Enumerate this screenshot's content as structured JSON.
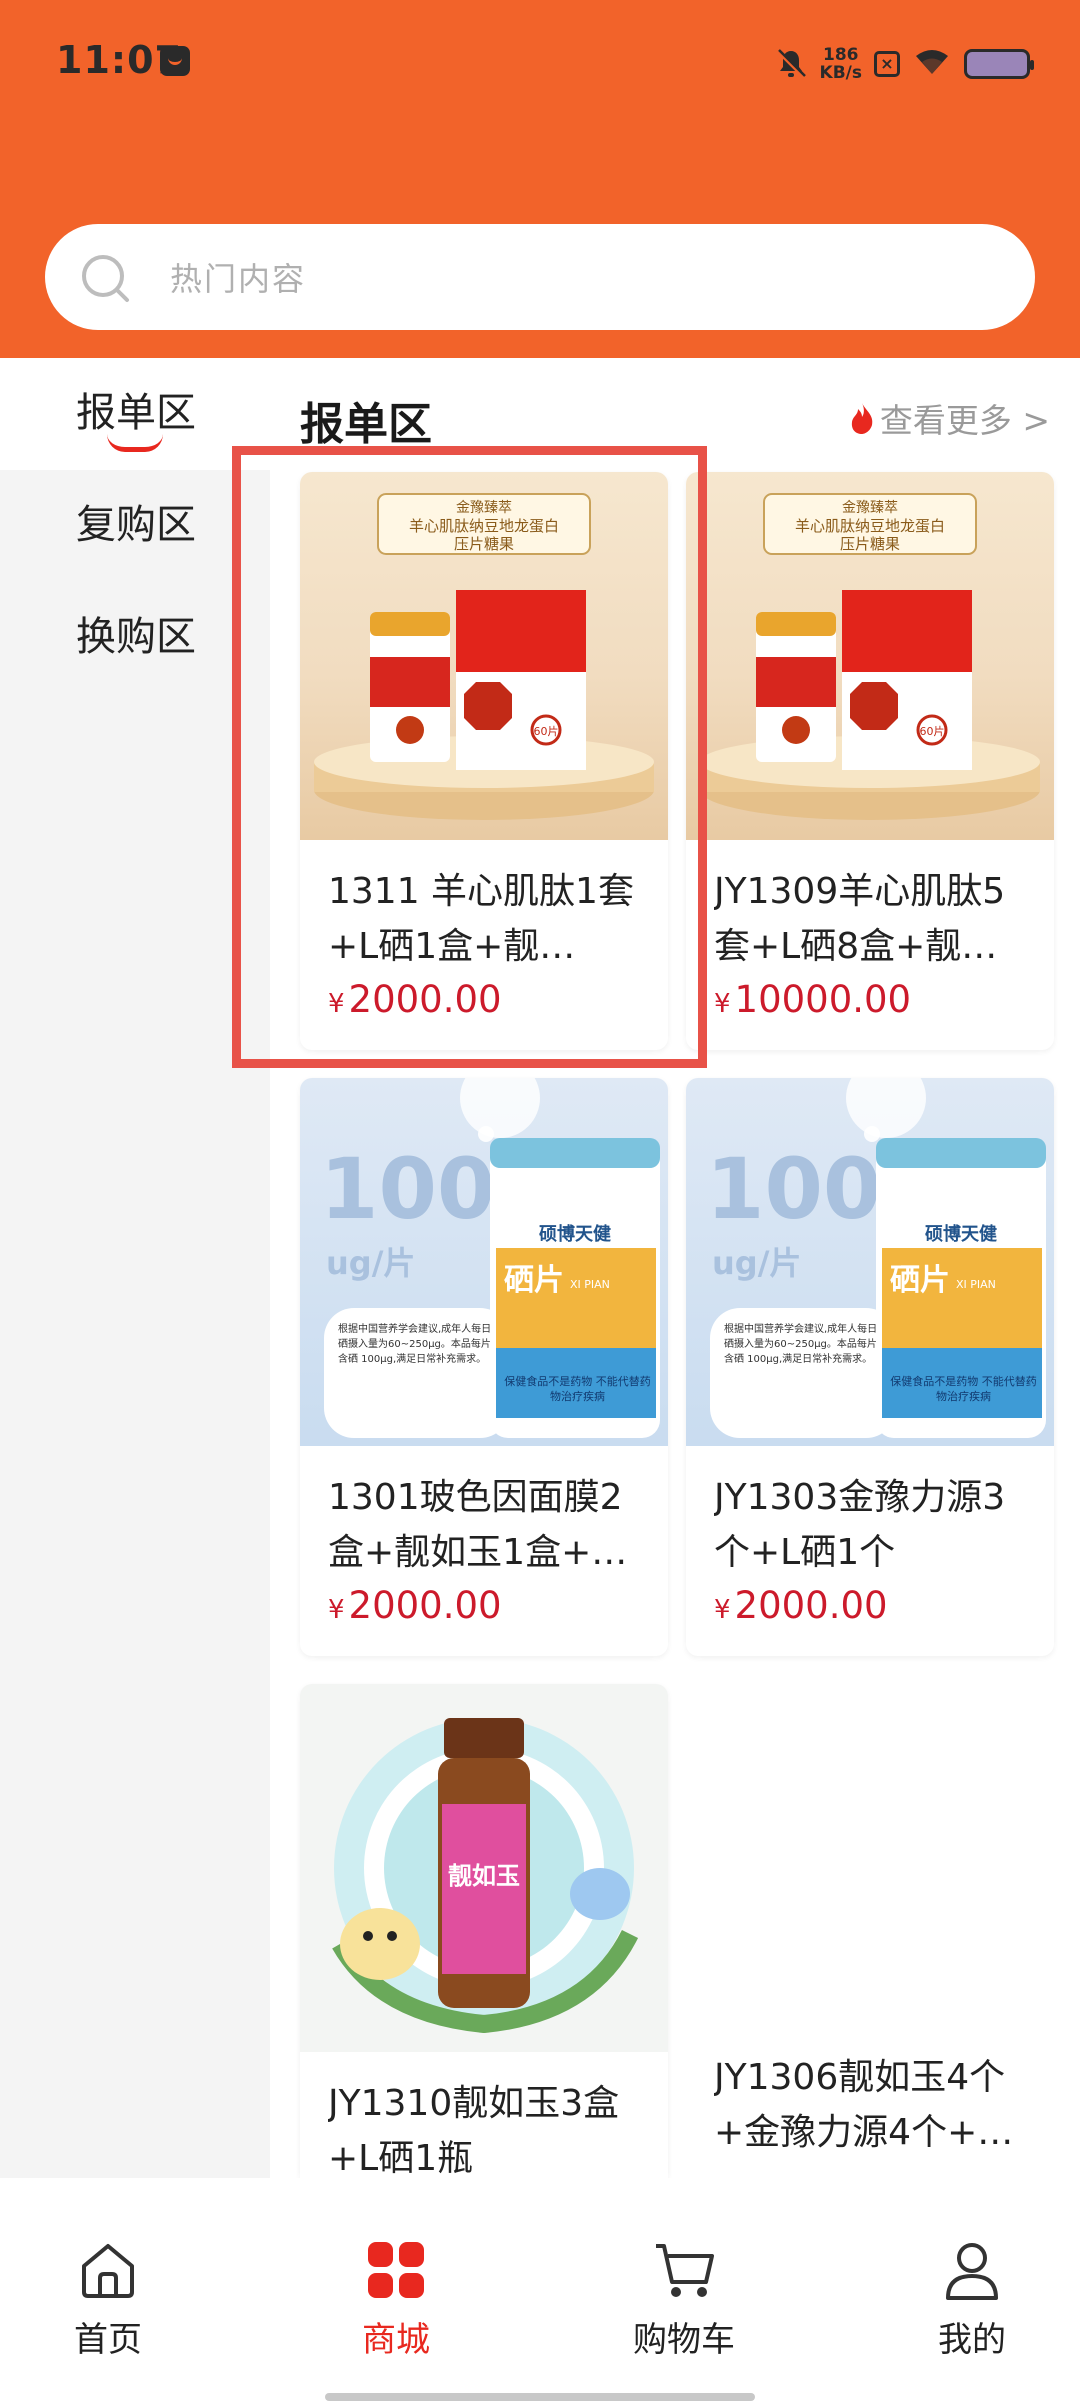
{
  "status_bar": {
    "time": "11:07",
    "net_speed_value": "186",
    "net_speed_unit": "KB/s"
  },
  "search": {
    "placeholder": "热门内容"
  },
  "sidebar": {
    "items": [
      {
        "label": "报单区",
        "active": true
      },
      {
        "label": "复购区",
        "active": false
      },
      {
        "label": "换购区",
        "active": false
      }
    ]
  },
  "section": {
    "title": "报单区",
    "more_label": "查看更多 >"
  },
  "products": [
    {
      "title": "1311 羊心肌肽1套+L硒1盒+靓…",
      "currency": "¥",
      "price": "2000.00",
      "image": "peptide-candy-box",
      "img_banner_line1": "金豫臻萃",
      "img_banner_line2": "羊心肌肽纳豆地龙蛋白",
      "img_banner_line3": "压片糖果",
      "img_count": "60片"
    },
    {
      "title": "JY1309羊心肌肽5套+L硒8盒+靓…",
      "currency": "¥",
      "price": "10000.00",
      "image": "peptide-candy-box",
      "img_banner_line1": "金豫臻萃",
      "img_banner_line2": "羊心肌肽纳豆地龙蛋白",
      "img_banner_line3": "压片糖果",
      "img_count": "60片"
    },
    {
      "title": "1301玻色因面膜2盒+靓如玉1盒+…",
      "currency": "¥",
      "price": "2000.00",
      "image": "selenium-tablets",
      "img_big": "100",
      "img_unit": "ug/片",
      "img_brand": "硕博天健",
      "img_name": "硒片",
      "img_name_en": "XI PIAN",
      "img_note": "根据中国营养学会建议,成年人每日硒摄入量为60~250μg。本品每片含硒 100μg,满足日常补充需求。",
      "img_warning": "保健食品不是药物 不能代替药物治疗疾病"
    },
    {
      "title": "JY1303金豫力源3个+L硒1个",
      "currency": "¥",
      "price": "2000.00",
      "image": "selenium-tablets",
      "img_big": "100",
      "img_unit": "ug/片",
      "img_brand": "硕博天健",
      "img_name": "硒片",
      "img_name_en": "XI PIAN",
      "img_note": "根据中国营养学会建议,成年人每日硒摄入量为60~250μg。本品每片含硒 100μg,满足日常补充需求。",
      "img_warning": "保健食品不是药物 不能代替药物治疗疾病"
    },
    {
      "title": "JY1310靓如玉3盒+L硒1瓶",
      "currency": "¥",
      "price": "",
      "image": "oral-liquid-bottle",
      "img_label": "靓如玉"
    },
    {
      "title": "JY1306靓如玉4个+金豫力源4个+…",
      "currency": "¥",
      "price": "",
      "image": "none"
    }
  ],
  "bottom_nav": [
    {
      "label": "首页",
      "icon": "home-icon",
      "active": false
    },
    {
      "label": "商城",
      "icon": "grid-icon",
      "active": true
    },
    {
      "label": "购物车",
      "icon": "cart-icon",
      "active": false
    },
    {
      "label": "我的",
      "icon": "person-icon",
      "active": false
    }
  ],
  "colors": {
    "brand": "#f2632a",
    "price": "#cc1a2b",
    "active_nav": "#e8281f",
    "selection_box": "#e85248"
  }
}
